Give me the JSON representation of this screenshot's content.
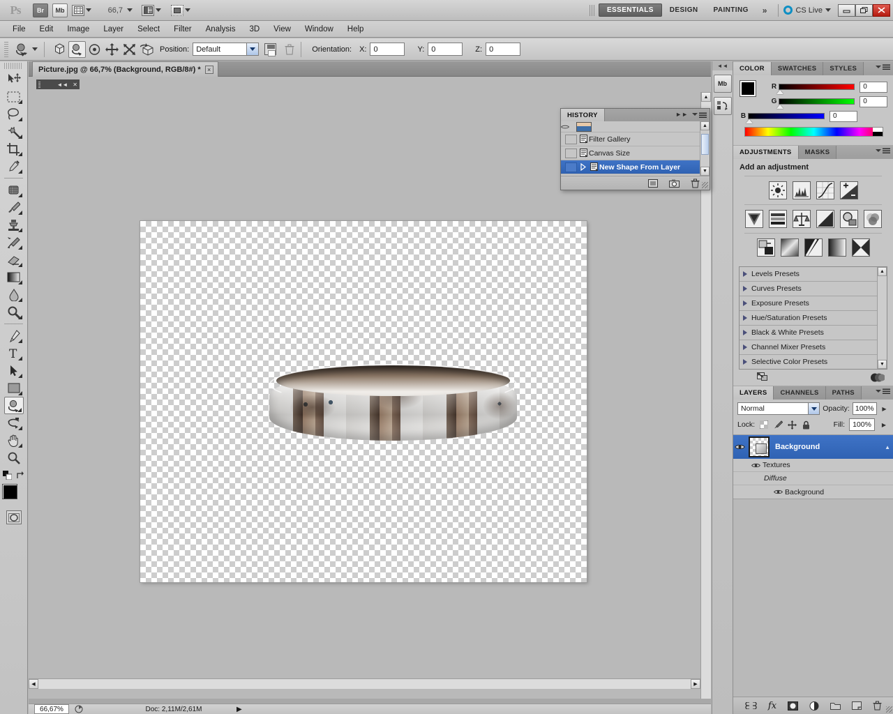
{
  "app": {
    "name": "Ps",
    "title_bar_buttons": [
      "minimize",
      "restore",
      "close"
    ],
    "launch_bridge": "Br",
    "launch_minibridge": "Mb",
    "zoom_level": "66,7",
    "cs_live": "CS Live"
  },
  "workspaces": {
    "items": [
      {
        "label": "ESSENTIALS",
        "active": true
      },
      {
        "label": "DESIGN",
        "active": false
      },
      {
        "label": "PAINTING",
        "active": false
      }
    ],
    "overflow": "»"
  },
  "menubar": {
    "items": [
      "File",
      "Edit",
      "Image",
      "Layer",
      "Select",
      "Filter",
      "Analysis",
      "3D",
      "View",
      "Window",
      "Help"
    ]
  },
  "options_bar": {
    "position_label": "Position:",
    "position_value": "Default",
    "orientation_label": "Orientation:",
    "x_label": "X:",
    "x_value": "0",
    "y_label": "Y:",
    "y_value": "0",
    "z_label": "Z:",
    "z_value": "0"
  },
  "document": {
    "tab_title": "Picture.jpg @ 66,7% (Background, RGB/8#) *",
    "close_glyph": "×"
  },
  "status_bar": {
    "zoom": "66,67%",
    "doc_info": "Doc: 2,11M/2,61M"
  },
  "history_panel": {
    "tab": "HISTORY",
    "items": [
      {
        "label": "Filter Gallery",
        "selected": false
      },
      {
        "label": "Canvas Size",
        "selected": false
      },
      {
        "label": "New Shape From Layer",
        "selected": true
      }
    ]
  },
  "color_panel": {
    "tabs": [
      "COLOR",
      "SWATCHES",
      "STYLES"
    ],
    "active_tab": "COLOR",
    "channels": [
      {
        "label": "R",
        "value": "0"
      },
      {
        "label": "G",
        "value": "0"
      },
      {
        "label": "B",
        "value": "0"
      }
    ],
    "foreground": "#000000",
    "background": "#ffffff"
  },
  "adjustments_panel": {
    "tabs": [
      "ADJUSTMENTS",
      "MASKS"
    ],
    "active_tab": "ADJUSTMENTS",
    "heading": "Add an adjustment",
    "icons_row1": [
      "brightness-contrast",
      "levels",
      "curves",
      "exposure"
    ],
    "icons_row2": [
      "vibrance",
      "hue-saturation",
      "color-balance",
      "black-white",
      "photo-filter",
      "channel-mixer"
    ],
    "icons_row3": [
      "invert",
      "posterize",
      "threshold",
      "gradient-map",
      "selective-color"
    ],
    "presets": [
      "Levels Presets",
      "Curves Presets",
      "Exposure Presets",
      "Hue/Saturation Presets",
      "Black & White Presets",
      "Channel Mixer Presets",
      "Selective Color Presets"
    ]
  },
  "layers_panel": {
    "tabs": [
      "LAYERS",
      "CHANNELS",
      "PATHS"
    ],
    "active_tab": "LAYERS",
    "blend_mode": "Normal",
    "opacity_label": "Opacity:",
    "opacity_value": "100%",
    "lock_label": "Lock:",
    "fill_label": "Fill:",
    "fill_value": "100%",
    "layers": [
      {
        "name": "Background",
        "selected": true,
        "type": "3d-layer"
      }
    ],
    "sub_items": [
      {
        "name": "Textures",
        "indent": 1,
        "eye": true,
        "italic": false
      },
      {
        "name": "Diffuse",
        "indent": 2,
        "eye": false,
        "italic": true
      },
      {
        "name": "Background",
        "indent": 3,
        "eye": true,
        "italic": false
      }
    ],
    "footer_icons": [
      "link-icon",
      "fx-icon",
      "add-mask-icon",
      "adjustment-icon",
      "new-group-icon",
      "new-layer-icon",
      "delete-layer-icon"
    ]
  },
  "toolbar": {
    "tools_top": [
      "move-tool",
      "marquee-tool",
      "lasso-tool",
      "magic-wand-tool",
      "crop-tool",
      "eyedropper-tool"
    ],
    "tools_mid": [
      "spot-healing-tool",
      "brush-tool",
      "clone-stamp-tool",
      "history-brush-tool",
      "eraser-tool",
      "gradient-tool",
      "blur-tool",
      "dodge-tool"
    ],
    "tools_bottom": [
      "pen-tool",
      "type-tool",
      "path-selection-tool",
      "shape-tool",
      "3d-object-rotate-tool",
      "3d-camera-rotate-tool",
      "hand-tool",
      "zoom-tool"
    ],
    "quick_mask": "edit-in-quick-mask-mode"
  },
  "dock_icons": [
    "mini-bridge-icon",
    "history-icon"
  ],
  "colors": {
    "accent_selection": "#2f62b3",
    "panel_bg": "#c6c6c6",
    "app_bg": "#b4b4b4",
    "close_button": "#b51a10"
  }
}
